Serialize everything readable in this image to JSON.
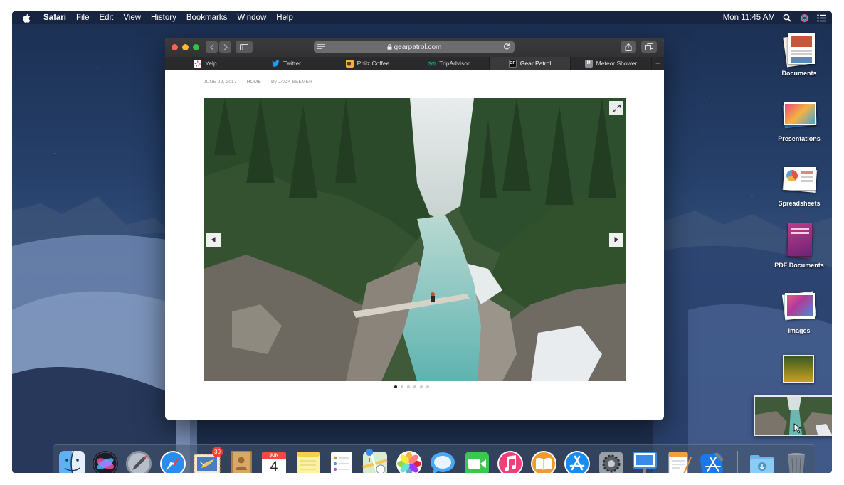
{
  "menubar": {
    "app": "Safari",
    "items": [
      "File",
      "Edit",
      "View",
      "History",
      "Bookmarks",
      "Window",
      "Help"
    ],
    "clock": "Mon 11:45 AM"
  },
  "safari": {
    "url": "gearpatrol.com",
    "tabs": [
      {
        "label": "Yelp",
        "icon": "yelp-icon",
        "color": "#d32323",
        "glyph": "✱"
      },
      {
        "label": "Twitter",
        "icon": "twitter-icon",
        "color": "#1da1f2",
        "glyph": ""
      },
      {
        "label": "Philz Coffee",
        "icon": "philz-icon",
        "color": "#c98a2b",
        "glyph": "☕"
      },
      {
        "label": "TripAdvisor",
        "icon": "tripadvisor-icon",
        "color": "#00a680",
        "glyph": "∞"
      },
      {
        "label": "Gear Patrol",
        "icon": "gearpatrol-icon",
        "color": "#111111",
        "glyph": "GP"
      },
      {
        "label": "Meteor Shower",
        "icon": "meteor-icon",
        "color": "#8e8e93",
        "glyph": "M"
      }
    ],
    "active_tab": 4,
    "article": {
      "date": "JUNE 29, 2017",
      "section": "HOME",
      "byline": "By JACK SEEMER"
    },
    "carousel": {
      "count": 6,
      "active": 0
    }
  },
  "desktop": {
    "stacks": [
      {
        "label": "Documents",
        "icon": "documents-stack-icon"
      },
      {
        "label": "Presentations",
        "icon": "presentations-stack-icon"
      },
      {
        "label": "Spreadsheets",
        "icon": "spreadsheets-stack-icon"
      },
      {
        "label": "PDF Documents",
        "icon": "pdf-stack-icon"
      },
      {
        "label": "Images",
        "icon": "images-stack-icon"
      }
    ]
  },
  "dock": {
    "apps": [
      {
        "name": "finder",
        "running": true
      },
      {
        "name": "siri",
        "running": false
      },
      {
        "name": "launchpad",
        "running": false
      },
      {
        "name": "safari",
        "running": true
      },
      {
        "name": "mail",
        "running": true,
        "badge": "30"
      },
      {
        "name": "contacts",
        "running": false
      },
      {
        "name": "calendar",
        "running": true,
        "month": "JUN",
        "day": "4"
      },
      {
        "name": "notes",
        "running": false
      },
      {
        "name": "reminders",
        "running": false
      },
      {
        "name": "maps",
        "running": false
      },
      {
        "name": "photos",
        "running": true
      },
      {
        "name": "messages",
        "running": true
      },
      {
        "name": "facetime",
        "running": false
      },
      {
        "name": "itunes",
        "running": true
      },
      {
        "name": "books",
        "running": false
      },
      {
        "name": "app-store",
        "running": false
      },
      {
        "name": "system-preferences",
        "running": false
      },
      {
        "name": "keynote",
        "running": true
      },
      {
        "name": "pages",
        "running": true
      },
      {
        "name": "xcode",
        "running": true
      },
      {
        "name": "downloads-folder",
        "running": false
      },
      {
        "name": "trash",
        "running": false
      }
    ]
  }
}
